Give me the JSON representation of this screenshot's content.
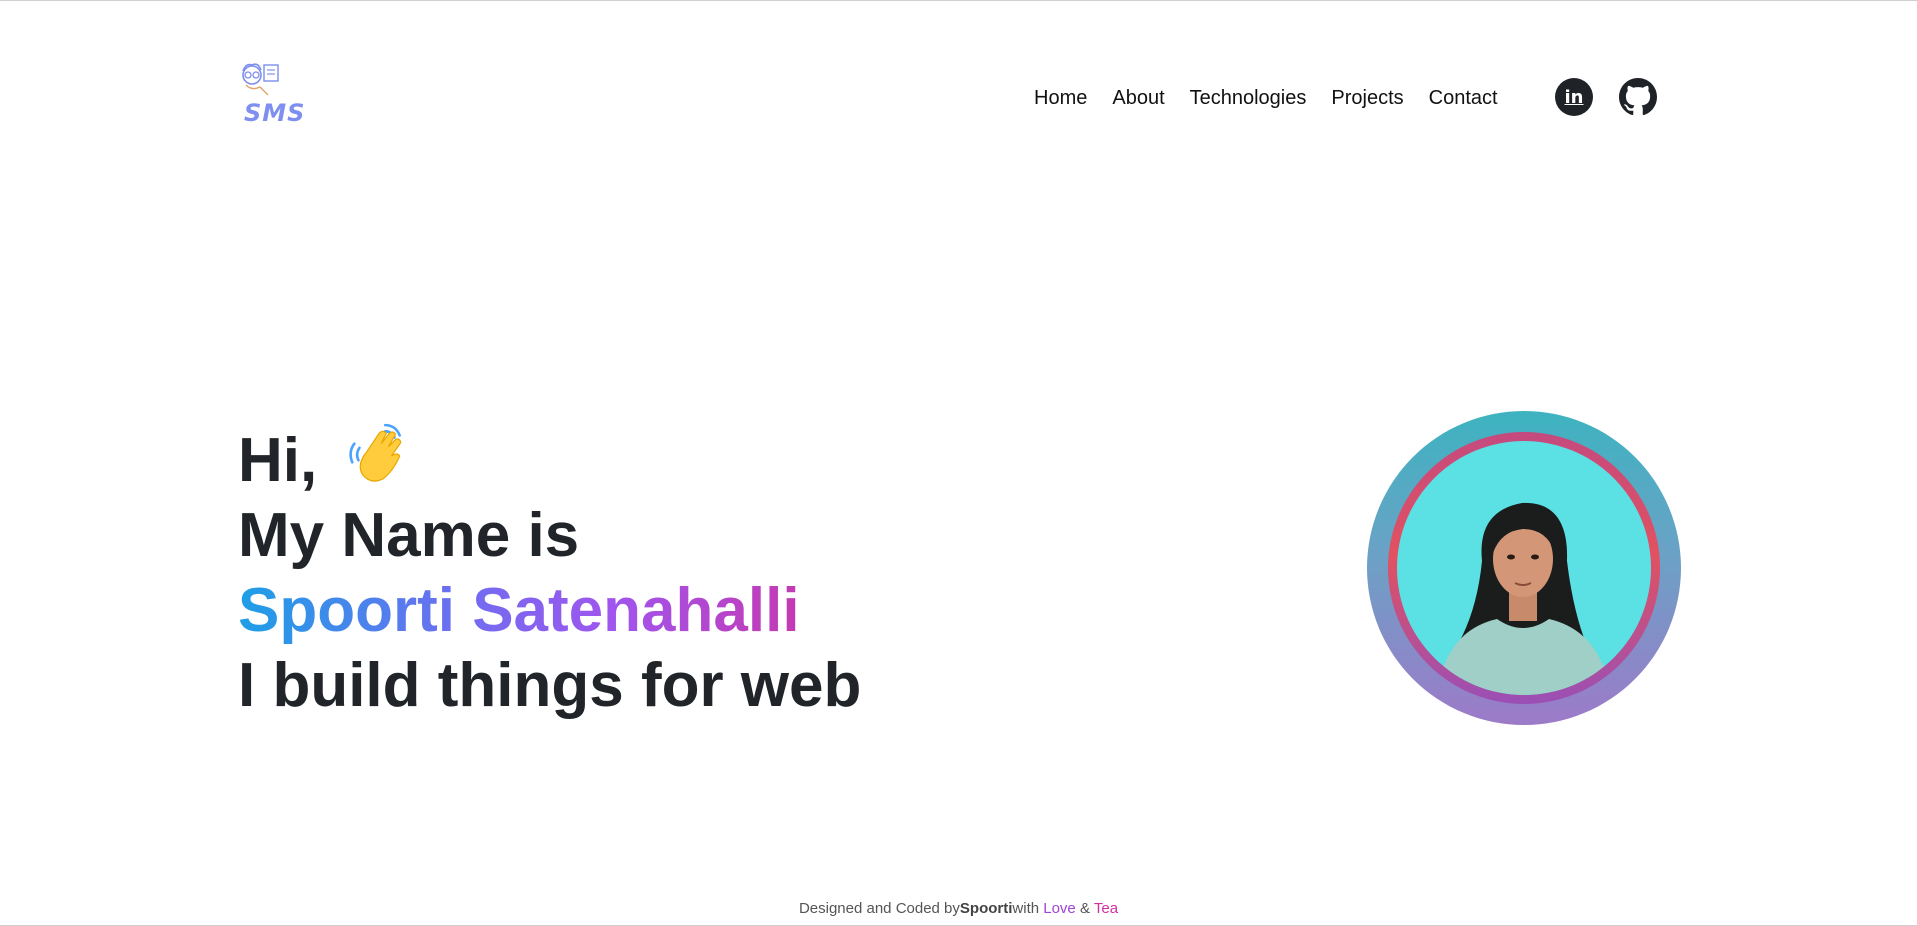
{
  "brand": {
    "logo_text": "SMS"
  },
  "nav": {
    "items": [
      "Home",
      "About",
      "Technologies",
      "Projects",
      "Contact"
    ]
  },
  "social": {
    "linkedin_label": "in",
    "icons": [
      "linkedin-icon",
      "github-icon"
    ]
  },
  "hero": {
    "greeting": "Hi,",
    "line2": "My Name is",
    "name": "Spoorti Satenahalli",
    "line4": "I build things for web"
  },
  "footer": {
    "prefix": "Designed and Coded by",
    "author": "Spoorti",
    "with": "with ",
    "love": "Love",
    "amp": " & ",
    "tea": "Tea"
  },
  "colors": {
    "gradient": [
      "#1d9fe6",
      "#6d6ef0",
      "#a055ee",
      "#d0319f"
    ],
    "avatar_bg": "#5be0e4",
    "logo": "#7e8ff0"
  }
}
